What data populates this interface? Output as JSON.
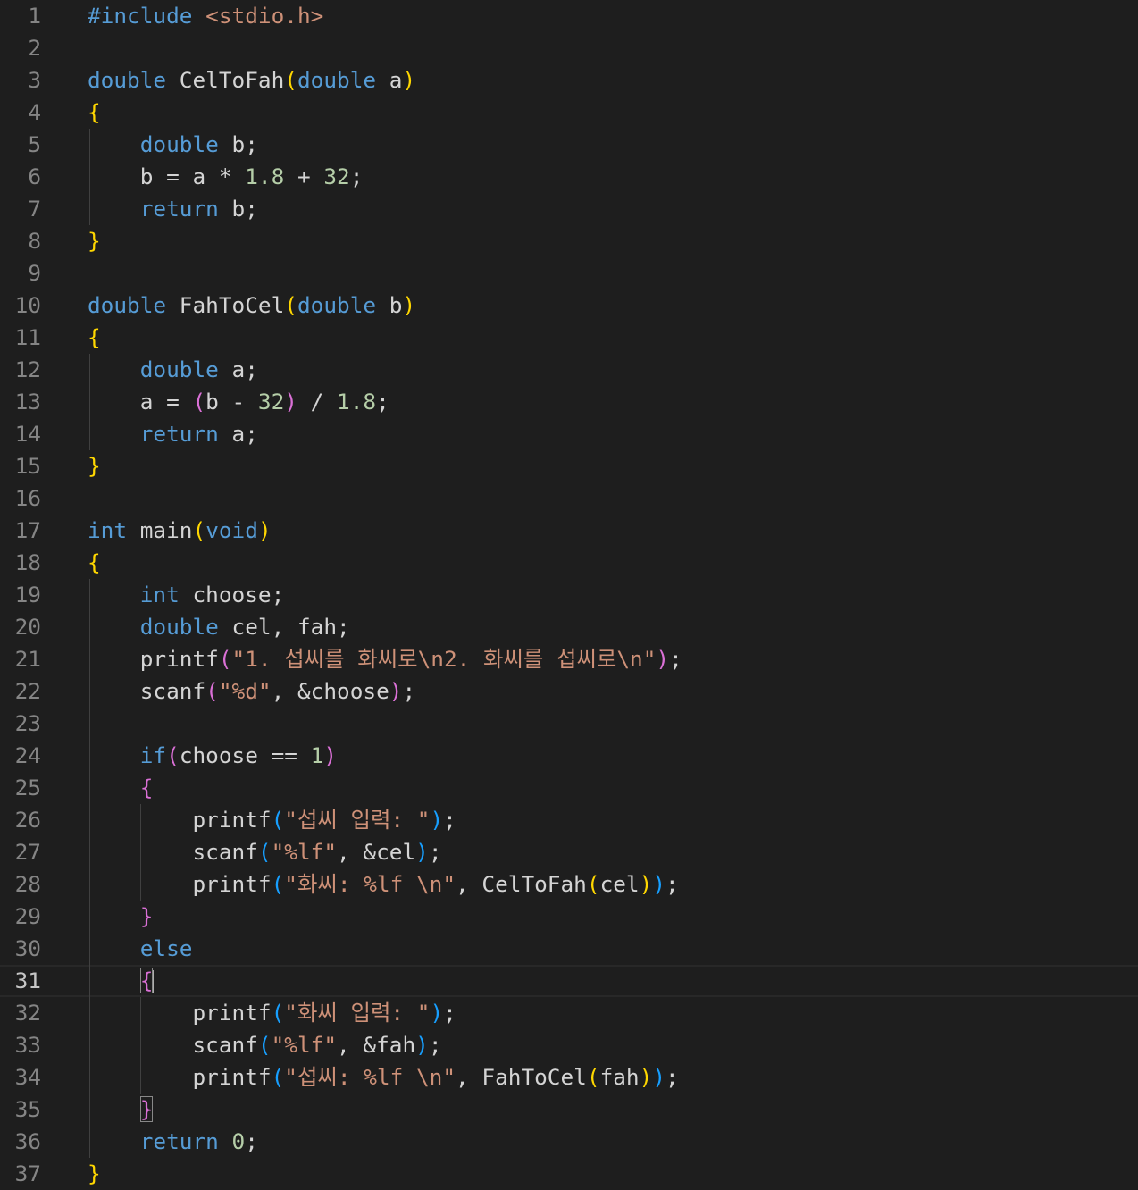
{
  "editor": {
    "language": "c",
    "current_line": 31,
    "theme_colors": {
      "background": "#1e1e1e",
      "default": "#d4d4d4",
      "keyword": "#569cd6",
      "control": "#c586c0",
      "string": "#ce9178",
      "number": "#b5cea8",
      "function": "#dcdcaa",
      "variable": "#9cdcfe",
      "line_number": "#858585",
      "bracket_gold": "#ffd700",
      "bracket_pink": "#da70d6",
      "bracket_blue": "#179fff"
    },
    "lines": [
      [
        [
          "#include ",
          "k"
        ],
        [
          "<stdio.h>",
          "s"
        ]
      ],
      [],
      [
        [
          "double",
          "k"
        ],
        [
          " CelToFah",
          ""
        ],
        [
          "(",
          "b1"
        ],
        [
          "double",
          "k"
        ],
        [
          " a",
          ""
        ],
        [
          ")",
          "b1"
        ]
      ],
      [
        [
          "{",
          "b1"
        ]
      ],
      [
        [
          "    ",
          ""
        ],
        [
          "double",
          "k"
        ],
        [
          " b;",
          ""
        ]
      ],
      [
        [
          "    b = a * ",
          ""
        ],
        [
          "1.8",
          "n"
        ],
        [
          " + ",
          ""
        ],
        [
          "32",
          "n"
        ],
        [
          ";",
          ""
        ]
      ],
      [
        [
          "    ",
          ""
        ],
        [
          "return",
          "k"
        ],
        [
          " b;",
          ""
        ]
      ],
      [
        [
          "}",
          "b1"
        ]
      ],
      [],
      [
        [
          "double",
          "k"
        ],
        [
          " FahToCel",
          ""
        ],
        [
          "(",
          "b1"
        ],
        [
          "double",
          "k"
        ],
        [
          " b",
          ""
        ],
        [
          ")",
          "b1"
        ]
      ],
      [
        [
          "{",
          "b1"
        ]
      ],
      [
        [
          "    ",
          ""
        ],
        [
          "double",
          "k"
        ],
        [
          " a;",
          ""
        ]
      ],
      [
        [
          "    a = ",
          ""
        ],
        [
          "(",
          "b2"
        ],
        [
          "b - ",
          ""
        ],
        [
          "32",
          "n"
        ],
        [
          ")",
          "b2"
        ],
        [
          " / ",
          ""
        ],
        [
          "1.8",
          "n"
        ],
        [
          ";",
          ""
        ]
      ],
      [
        [
          "    ",
          ""
        ],
        [
          "return",
          "k"
        ],
        [
          " a;",
          ""
        ]
      ],
      [
        [
          "}",
          "b1"
        ]
      ],
      [],
      [
        [
          "int",
          "k"
        ],
        [
          " main",
          ""
        ],
        [
          "(",
          "b1"
        ],
        [
          "void",
          "k"
        ],
        [
          ")",
          "b1"
        ]
      ],
      [
        [
          "{",
          "b1"
        ]
      ],
      [
        [
          "    ",
          ""
        ],
        [
          "int",
          "k"
        ],
        [
          " choose;",
          ""
        ]
      ],
      [
        [
          "    ",
          ""
        ],
        [
          "double",
          "k"
        ],
        [
          " cel, fah;",
          ""
        ]
      ],
      [
        [
          "    printf",
          ""
        ],
        [
          "(",
          "b2"
        ],
        [
          "\"1. 섭씨를 화씨로\\n2. 화씨를 섭씨로\\n\"",
          "s"
        ],
        [
          ")",
          "b2"
        ],
        [
          ";",
          ""
        ]
      ],
      [
        [
          "    scanf",
          ""
        ],
        [
          "(",
          "b2"
        ],
        [
          "\"%d\"",
          "s"
        ],
        [
          ", &choose",
          ""
        ],
        [
          ")",
          "b2"
        ],
        [
          ";",
          ""
        ]
      ],
      [],
      [
        [
          "    ",
          ""
        ],
        [
          "if",
          "k"
        ],
        [
          "(",
          "b2"
        ],
        [
          "choose == ",
          ""
        ],
        [
          "1",
          "n"
        ],
        [
          ")",
          "b2"
        ]
      ],
      [
        [
          "    ",
          ""
        ],
        [
          "{",
          "b2"
        ]
      ],
      [
        [
          "        printf",
          ""
        ],
        [
          "(",
          "b3"
        ],
        [
          "\"섭씨 입력: \"",
          "s"
        ],
        [
          ")",
          "b3"
        ],
        [
          ";",
          ""
        ]
      ],
      [
        [
          "        scanf",
          ""
        ],
        [
          "(",
          "b3"
        ],
        [
          "\"%lf\"",
          "s"
        ],
        [
          ", &cel",
          ""
        ],
        [
          ")",
          "b3"
        ],
        [
          ";",
          ""
        ]
      ],
      [
        [
          "        printf",
          ""
        ],
        [
          "(",
          "b3"
        ],
        [
          "\"화씨: %lf \\n\"",
          "s"
        ],
        [
          ", CelToFah",
          ""
        ],
        [
          "(",
          "b1"
        ],
        [
          "cel",
          ""
        ],
        [
          ")",
          "b1"
        ],
        [
          ")",
          "b3"
        ],
        [
          ";",
          ""
        ]
      ],
      [
        [
          "    ",
          ""
        ],
        [
          "}",
          "b2"
        ]
      ],
      [
        [
          "    ",
          ""
        ],
        [
          "else",
          "k"
        ]
      ],
      [
        [
          "    ",
          ""
        ],
        [
          "{",
          "b2m"
        ]
      ],
      [
        [
          "        printf",
          ""
        ],
        [
          "(",
          "b3"
        ],
        [
          "\"화씨 입력: \"",
          "s"
        ],
        [
          ")",
          "b3"
        ],
        [
          ";",
          ""
        ]
      ],
      [
        [
          "        scanf",
          ""
        ],
        [
          "(",
          "b3"
        ],
        [
          "\"%lf\"",
          "s"
        ],
        [
          ", &fah",
          ""
        ],
        [
          ")",
          "b3"
        ],
        [
          ";",
          ""
        ]
      ],
      [
        [
          "        printf",
          ""
        ],
        [
          "(",
          "b3"
        ],
        [
          "\"섭씨: %lf \\n\"",
          "s"
        ],
        [
          ", FahToCel",
          ""
        ],
        [
          "(",
          "b1"
        ],
        [
          "fah",
          ""
        ],
        [
          ")",
          "b1"
        ],
        [
          ")",
          "b3"
        ],
        [
          ";",
          ""
        ]
      ],
      [
        [
          "    ",
          ""
        ],
        [
          "}",
          "b2m"
        ]
      ],
      [
        [
          "    ",
          ""
        ],
        [
          "return",
          "k"
        ],
        [
          " ",
          ""
        ],
        [
          "0",
          "n"
        ],
        [
          ";",
          ""
        ]
      ],
      [
        [
          "}",
          "b1"
        ]
      ]
    ]
  }
}
